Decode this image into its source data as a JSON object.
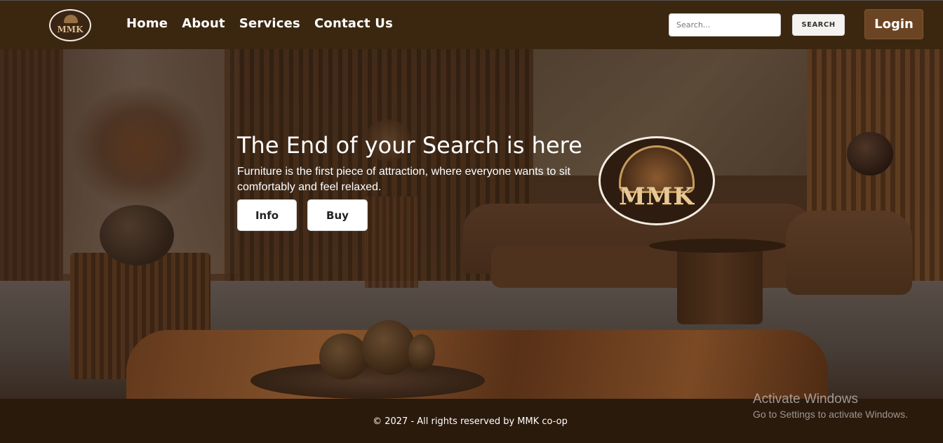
{
  "brand": {
    "logo_text": "MMK"
  },
  "nav": {
    "links": [
      "Home",
      "About",
      "Services",
      "Contact Us"
    ]
  },
  "search": {
    "placeholder": "Search...",
    "button_label": "SEARCH"
  },
  "login": {
    "label": "Login"
  },
  "hero": {
    "title": "The End of your Search is here",
    "subtitle": "Furniture is the first piece of attraction, where everyone wants to sit comfortably and feel relaxed.",
    "info_label": "Info",
    "buy_label": "Buy"
  },
  "footer": {
    "copyright": "© 2027 - All rights reserved by MMK co-op"
  },
  "watermark": {
    "line1": "Activate Windows",
    "line2": "Go to Settings to activate Windows."
  },
  "colors": {
    "navbar": "#3b2710",
    "footer": "#2a1a0c",
    "login_button": "#6b4523"
  }
}
